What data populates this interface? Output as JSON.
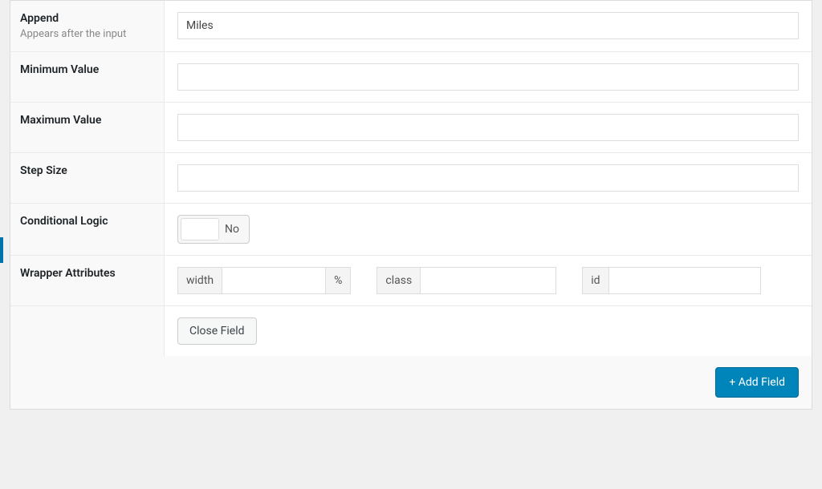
{
  "fields": {
    "append": {
      "label": "Append",
      "desc": "Appears after the input",
      "value": "Miles"
    },
    "minimum_value": {
      "label": "Minimum Value",
      "value": ""
    },
    "maximum_value": {
      "label": "Maximum Value",
      "value": ""
    },
    "step_size": {
      "label": "Step Size",
      "value": ""
    },
    "conditional_logic": {
      "label": "Conditional Logic",
      "state": "No"
    },
    "wrapper_attributes": {
      "label": "Wrapper Attributes",
      "width": {
        "prefix": "width",
        "value": "",
        "suffix": "%"
      },
      "class": {
        "prefix": "class",
        "value": ""
      },
      "id": {
        "prefix": "id",
        "value": ""
      }
    }
  },
  "buttons": {
    "close_field": "Close Field",
    "add_field": "+ Add Field"
  }
}
